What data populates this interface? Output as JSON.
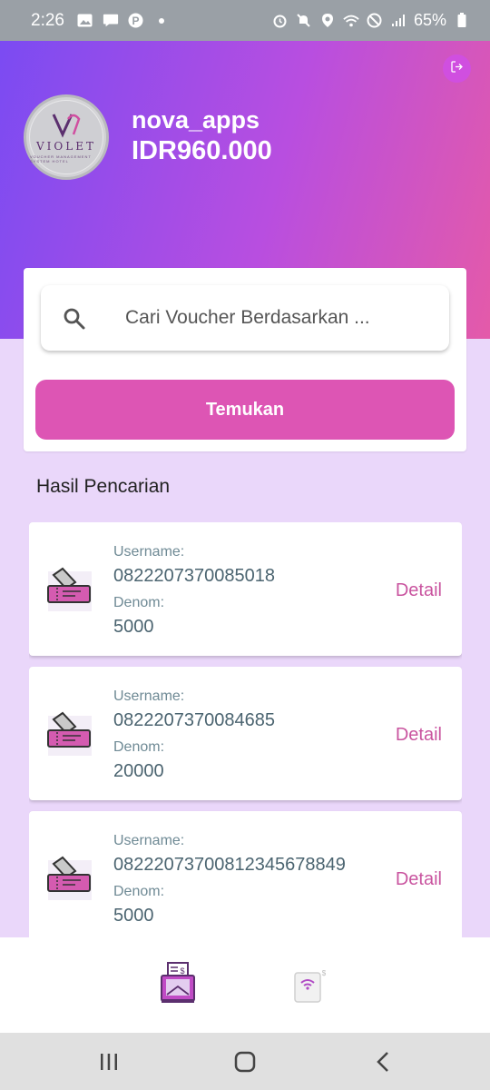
{
  "status_bar": {
    "time": "2:26",
    "battery": "65%",
    "left_icons": [
      "image-icon",
      "message-icon",
      "pinterest-icon",
      "dot-icon"
    ],
    "right_icons": [
      "alarm-icon",
      "mute-icon",
      "location-icon",
      "wifi-icon",
      "no-disturb-icon",
      "signal-icon",
      "battery-icon"
    ]
  },
  "header": {
    "logo_text": "VIOLET",
    "logo_subtext": "VOUCHER MANAGEMENT SYSTEM HOTEL",
    "username": "nova_apps",
    "balance": "IDR960.000",
    "gradient_start": "#7b4bf2",
    "gradient_end": "#e45aa9",
    "logout_icon": "logout-icon"
  },
  "search": {
    "placeholder": "Cari Voucher Berdasarkan ...",
    "button_label": "Temukan",
    "button_color": "#dd55b4"
  },
  "results": {
    "title": "Hasil Pencarian",
    "items": [
      {
        "username_label": "Username:",
        "username": "0822207370085018",
        "denom_label": "Denom:",
        "denom": "5000",
        "detail_label": "Detail"
      },
      {
        "username_label": "Username:",
        "username": "0822207370084685",
        "denom_label": "Denom:",
        "denom": "20000",
        "detail_label": "Detail"
      },
      {
        "username_label": "Username:",
        "username": "08222073700812345678849",
        "denom_label": "Denom:",
        "denom": "5000",
        "detail_label": "Detail"
      }
    ]
  },
  "bottom_nav": {
    "items": [
      {
        "icon": "voucher-mailbox-icon",
        "active": true
      },
      {
        "icon": "wifi-device-icon",
        "active": false
      }
    ]
  },
  "system_nav": {
    "buttons": [
      "recent-apps-icon",
      "home-icon",
      "back-icon"
    ]
  }
}
